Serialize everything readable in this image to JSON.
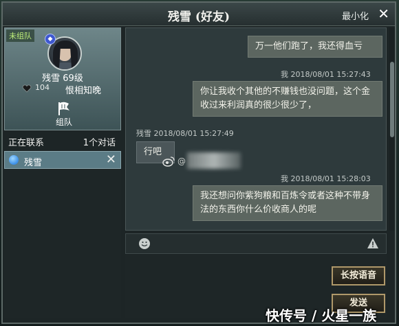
{
  "window": {
    "title": "残雪 (好友)",
    "minimize_label": "最小化"
  },
  "profile": {
    "team_status": "未组队",
    "name_level": "残雪 69级",
    "intimacy": "104",
    "relation": "恨相知晚",
    "team_button_label": "组队"
  },
  "contacts": {
    "header_left": "正在联系",
    "header_right": "1个对话",
    "items": [
      {
        "name": "残雪"
      }
    ]
  },
  "messages": [
    {
      "sender": "me",
      "text": "万一他们跑了，我还得血亏"
    },
    {
      "sender": "me",
      "meta": "我  2018/08/01  15:27:43",
      "text": "你让我收个其他的不赚钱也没问题，这个金收过来利润真的很少很少了，"
    },
    {
      "sender": "them",
      "meta": "残雪  2018/08/01  15:27:49",
      "text": "行吧"
    },
    {
      "sender": "me",
      "meta": "我  2018/08/01  15:28:03",
      "text": "我还想问你紫狗粮和百炼令或者这种不带身法的东西你什么价收商人的呢"
    }
  ],
  "watermark": {
    "inline": "@",
    "footer": "快传号 / 火星一族"
  },
  "actions": {
    "voice_label": "长按语音",
    "send_label": "发送"
  },
  "colors": {
    "team_status": "#bff07a",
    "button_border": "#b0996a"
  }
}
